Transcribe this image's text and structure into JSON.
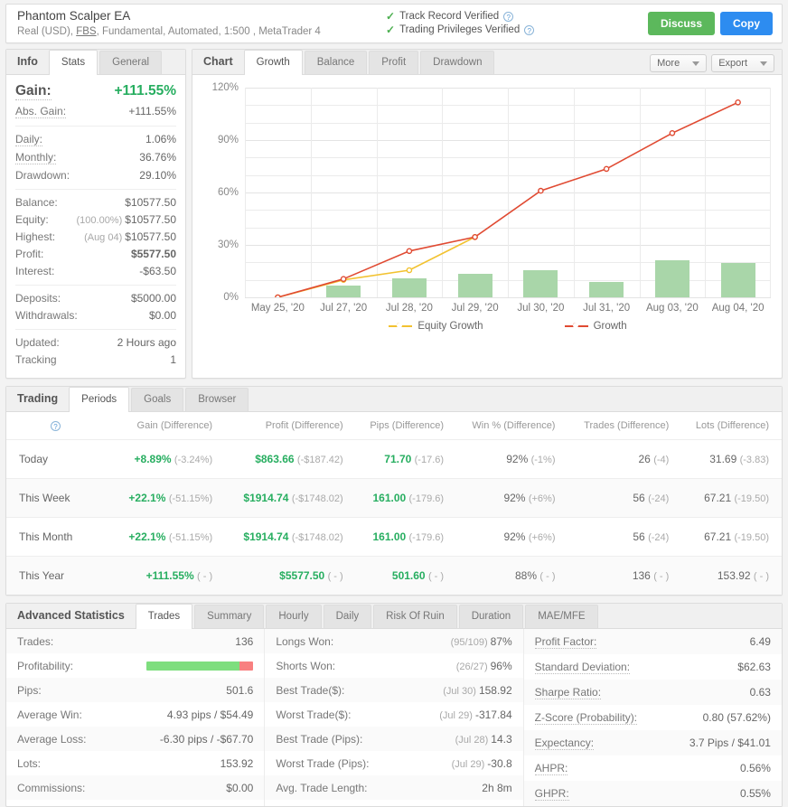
{
  "header": {
    "title": "Phantom Scalper EA",
    "subtitle_pre": "Real (USD), ",
    "broker": "FBS",
    "subtitle_post": ", Fundamental, Automated, 1:500 , MetaTrader 4",
    "verified": [
      {
        "label": "Track Record Verified"
      },
      {
        "label": "Trading Privileges Verified"
      }
    ],
    "discuss_label": "Discuss",
    "copy_label": "Copy"
  },
  "info": {
    "section_title": "Info",
    "tabs": [
      {
        "label": "Stats",
        "active": true
      },
      {
        "label": "General",
        "active": false
      }
    ],
    "rows": [
      {
        "label": "Gain:",
        "value": "+111.55%"
      },
      {
        "label": "Abs. Gain:",
        "value": "+111.55%"
      },
      {
        "label": "Daily:",
        "value": "1.06%"
      },
      {
        "label": "Monthly:",
        "value": "36.76%"
      },
      {
        "label": "Drawdown:",
        "value": "29.10%"
      },
      {
        "label": "Balance:",
        "value": "$10577.50"
      },
      {
        "label": "Equity:",
        "prefix": "(100.00%)",
        "value": "$10577.50"
      },
      {
        "label": "Highest:",
        "prefix": "(Aug 04)",
        "value": "$10577.50"
      },
      {
        "label": "Profit:",
        "value": "$5577.50"
      },
      {
        "label": "Interest:",
        "value": "-$63.50"
      },
      {
        "label": "Deposits:",
        "value": "$5000.00"
      },
      {
        "label": "Withdrawals:",
        "value": "$0.00"
      },
      {
        "label": "Updated:",
        "value": "2 Hours ago"
      },
      {
        "label": "Tracking",
        "value": "1"
      }
    ]
  },
  "chart_panel": {
    "section_title": "Chart",
    "tabs": [
      {
        "label": "Growth",
        "active": true
      },
      {
        "label": "Balance",
        "active": false
      },
      {
        "label": "Profit",
        "active": false
      },
      {
        "label": "Drawdown",
        "active": false
      }
    ],
    "more_label": "More",
    "export_label": "Export"
  },
  "chart_data": {
    "type": "line",
    "title": "Growth",
    "xlabel": "",
    "ylabel": "",
    "ylim": [
      0,
      120
    ],
    "yticks": [
      0,
      30,
      60,
      90,
      120
    ],
    "ytick_labels": [
      "0%",
      "30%",
      "60%",
      "90%",
      "120%"
    ],
    "grid": true,
    "legend_position": "bottom",
    "categories": [
      "May 25, '20",
      "Jul 27, '20",
      "Jul 28, '20",
      "Jul 29, '20",
      "Jul 30, '20",
      "Jul 31, '20",
      "Aug 03, '20",
      "Aug 04, '20"
    ],
    "series": [
      {
        "name": "Equity Growth",
        "type": "line",
        "color": "#f2c230",
        "values": [
          0,
          10.0,
          15.5,
          34.5,
          null,
          null,
          null,
          null
        ]
      },
      {
        "name": "Growth",
        "type": "line",
        "color": "#e04a32",
        "values": [
          0,
          10.5,
          26.5,
          34.5,
          61.0,
          73.5,
          94.0,
          111.55
        ]
      },
      {
        "name": "Monthly bars",
        "type": "bar",
        "color": "#a9d6a9",
        "values": [
          0,
          6.5,
          11.0,
          13.5,
          15.5,
          9.0,
          21.0,
          19.5
        ]
      }
    ]
  },
  "trading": {
    "section_title": "Trading",
    "tabs": [
      {
        "label": "Periods",
        "active": true
      },
      {
        "label": "Goals",
        "active": false
      },
      {
        "label": "Browser",
        "active": false
      }
    ],
    "columns": [
      "",
      "Gain (Difference)",
      "Profit (Difference)",
      "Pips (Difference)",
      "Win % (Difference)",
      "Trades (Difference)",
      "Lots (Difference)"
    ],
    "rows": [
      {
        "period": "Today",
        "gain": "+8.89%",
        "gain_diff": "(-3.24%)",
        "profit": "$863.66",
        "profit_diff": "(-$187.42)",
        "pips": "71.70",
        "pips_diff": "(-17.6)",
        "win": "92%",
        "win_diff": "(-1%)",
        "trades": "26",
        "trades_diff": "(-4)",
        "lots": "31.69",
        "lots_diff": "(-3.83)"
      },
      {
        "period": "This Week",
        "gain": "+22.1%",
        "gain_diff": "(-51.15%)",
        "profit": "$1914.74",
        "profit_diff": "(-$1748.02)",
        "pips": "161.00",
        "pips_diff": "(-179.6)",
        "win": "92%",
        "win_diff": "(+6%)",
        "trades": "56",
        "trades_diff": "(-24)",
        "lots": "67.21",
        "lots_diff": "(-19.50)"
      },
      {
        "period": "This Month",
        "gain": "+22.1%",
        "gain_diff": "(-51.15%)",
        "profit": "$1914.74",
        "profit_diff": "(-$1748.02)",
        "pips": "161.00",
        "pips_diff": "(-179.6)",
        "win": "92%",
        "win_diff": "(+6%)",
        "trades": "56",
        "trades_diff": "(-24)",
        "lots": "67.21",
        "lots_diff": "(-19.50)"
      },
      {
        "period": "This Year",
        "gain": "+111.55%",
        "gain_diff": "( - )",
        "profit": "$5577.50",
        "profit_diff": "( - )",
        "pips": "501.60",
        "pips_diff": "( - )",
        "win": "88%",
        "win_diff": "( - )",
        "trades": "136",
        "trades_diff": "( - )",
        "lots": "153.92",
        "lots_diff": "( - )"
      }
    ]
  },
  "advanced": {
    "section_title": "Advanced Statistics",
    "tabs": [
      {
        "label": "Trades",
        "active": true
      },
      {
        "label": "Summary",
        "active": false
      },
      {
        "label": "Hourly",
        "active": false
      },
      {
        "label": "Daily",
        "active": false
      },
      {
        "label": "Risk Of Ruin",
        "active": false
      },
      {
        "label": "Duration",
        "active": false
      },
      {
        "label": "MAE/MFE",
        "active": false
      }
    ],
    "col1": [
      {
        "label": "Trades:",
        "value": "136"
      },
      {
        "label": "Profitability:",
        "value": "",
        "bar": {
          "green_pct": 87,
          "red_pct": 13
        }
      },
      {
        "label": "Pips:",
        "value": "501.6"
      },
      {
        "label": "Average Win:",
        "value": "4.93 pips / $54.49"
      },
      {
        "label": "Average Loss:",
        "value": "-6.30 pips / -$67.70"
      },
      {
        "label": "Lots:",
        "value": "153.92"
      },
      {
        "label": "Commissions:",
        "value": "$0.00"
      }
    ],
    "col2": [
      {
        "label": "Longs Won:",
        "prefix": "(95/109)",
        "value": "87%"
      },
      {
        "label": "Shorts Won:",
        "prefix": "(26/27)",
        "value": "96%"
      },
      {
        "label": "Best Trade($):",
        "prefix": "(Jul 30)",
        "value": "158.92"
      },
      {
        "label": "Worst Trade($):",
        "prefix": "(Jul 29)",
        "value": "-317.84"
      },
      {
        "label": "Best Trade (Pips):",
        "prefix": "(Jul 28)",
        "value": "14.3"
      },
      {
        "label": "Worst Trade (Pips):",
        "prefix": "(Jul 29)",
        "value": "-30.8"
      },
      {
        "label": "Avg. Trade Length:",
        "value": "2h 8m"
      }
    ],
    "col3": [
      {
        "label": "Profit Factor:",
        "value": "6.49",
        "underline": true
      },
      {
        "label": "Standard Deviation:",
        "value": "$62.63",
        "underline": true
      },
      {
        "label": "Sharpe Ratio:",
        "value": "0.63",
        "underline": true
      },
      {
        "label": "Z-Score (Probability):",
        "value": "0.80 (57.62%)",
        "underline": true
      },
      {
        "label": "Expectancy:",
        "value": "3.7 Pips / $41.01",
        "underline": true
      },
      {
        "label": "AHPR:",
        "value": "0.56%",
        "underline": true
      },
      {
        "label": "GHPR:",
        "value": "0.55%",
        "underline": true
      }
    ]
  }
}
